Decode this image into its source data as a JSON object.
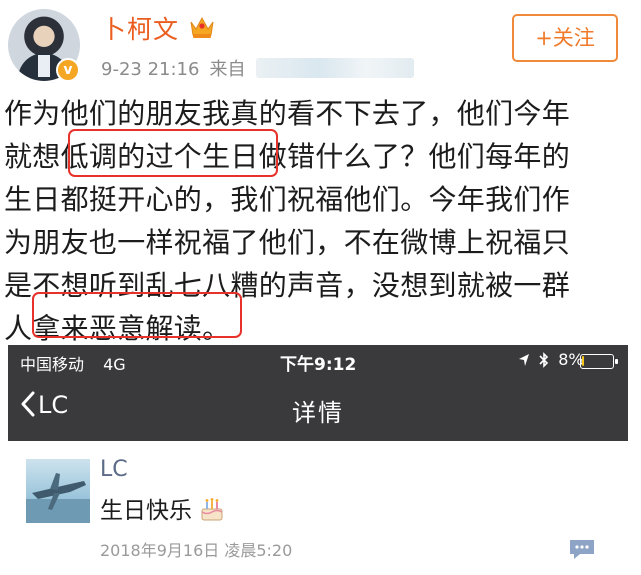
{
  "post": {
    "user_name": "卜柯文",
    "verified_mark": "v",
    "date": "9-23 21:16",
    "source_label": "来自",
    "follow_label": "+关注",
    "body_lines": [
      "作为他们的朋友我真的看不下去了，他们今年",
      "就想低调的过个生日做错什么了？他们每年的",
      "生日都挺开心的，我们祝福他们。今年我们作",
      "为朋友也一样祝福了他们，不在微博上祝福只",
      "是不想听到乱七八糟的声音，没想到就被一群",
      "人拿来恶意解读。"
    ],
    "highlight_color": "#e8312a",
    "accent_color": "#ea5d1f"
  },
  "chat_screenshot": {
    "status_bar": {
      "carrier": "中国移动",
      "network": "4G",
      "time": "下午9:12",
      "battery_text": "8%",
      "battery_level": 0.08
    },
    "nav": {
      "back_label": "LC",
      "title": "详情"
    },
    "message": {
      "sender": "LC",
      "text": "生日快乐",
      "timestamp": "2018年9月16日 凌晨5:20"
    }
  }
}
